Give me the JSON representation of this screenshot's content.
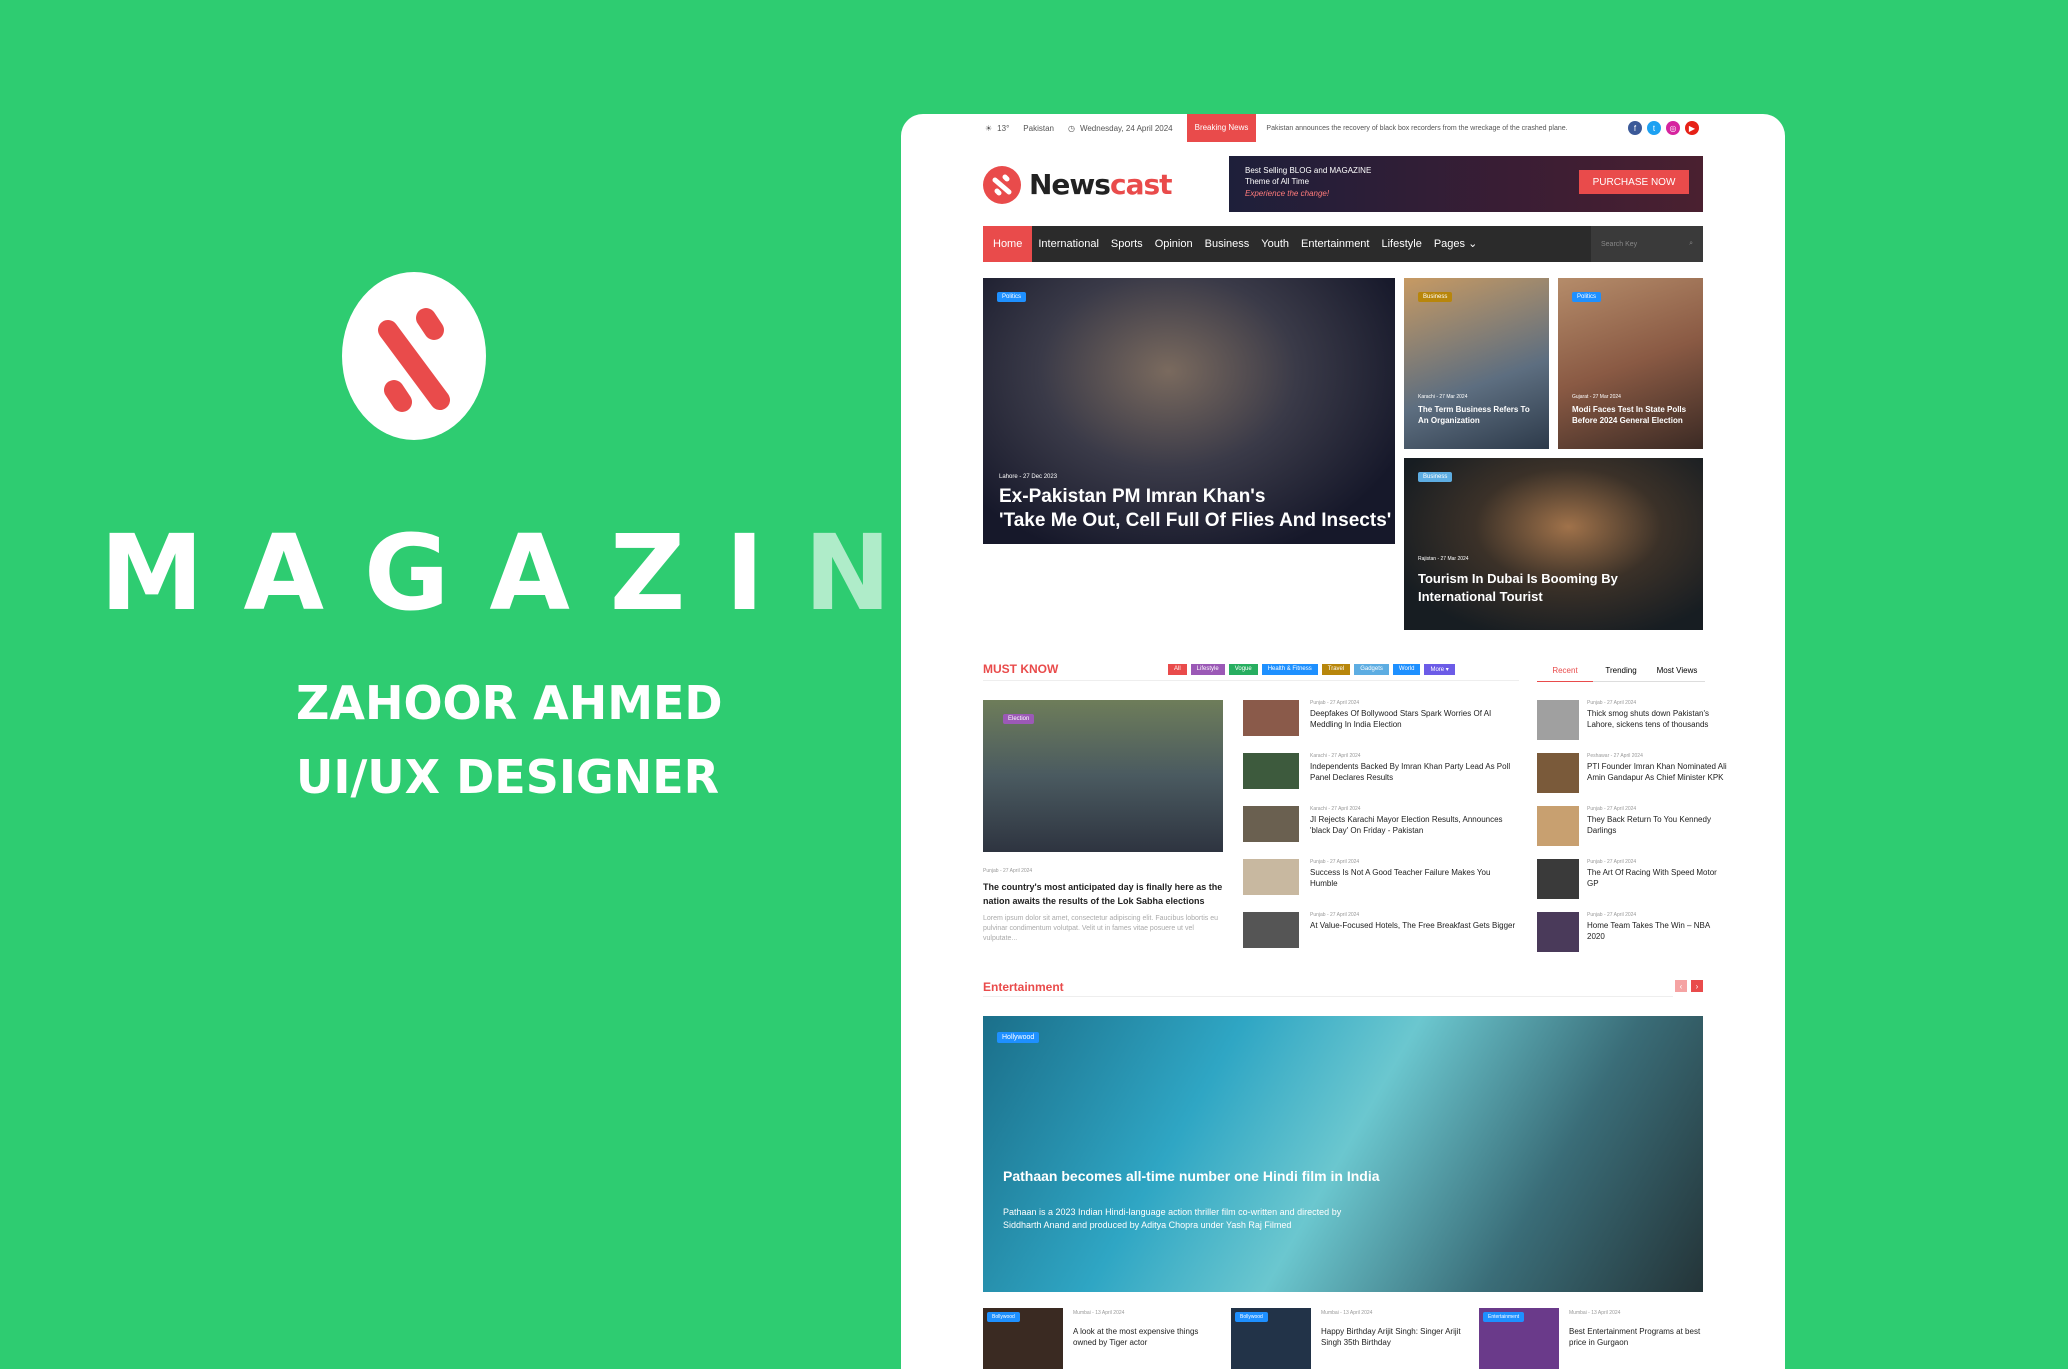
{
  "brand": {
    "word_main": "MAGAZI",
    "word_fade": "NE",
    "author": "ZAHOOR AHMED",
    "role": "UI/UX DESIGNER",
    "accent": "#e94b4b",
    "background": "#2ecc71"
  },
  "topbar": {
    "temperature": "13°",
    "location": "Pakistan",
    "date": "Wednesday, 24 April 2024",
    "breaking_label": "Breaking News",
    "breaking_text": "Pakistan announces the recovery of black box recorders from the wreckage of the crashed plane.",
    "socials": [
      {
        "icon": "facebook-icon",
        "glyph": "f",
        "color": "#3b5998"
      },
      {
        "icon": "twitter-icon",
        "glyph": "t",
        "color": "#1da1f2"
      },
      {
        "icon": "instagram-icon",
        "glyph": "◎",
        "color": "#d6249f"
      },
      {
        "icon": "youtube-icon",
        "glyph": "▶",
        "color": "#e62117"
      }
    ]
  },
  "header": {
    "logo_a": "News",
    "logo_b": "cast",
    "promo_line1": "Best Selling BLOG and MAGAZINE",
    "promo_line2": "Theme of All Time",
    "promo_line3": "Experience the change!",
    "promo_button": "PURCHASE NOW"
  },
  "nav": {
    "items": [
      "Home",
      "International",
      "Sports",
      "Opinion",
      "Business",
      "Youth",
      "Entertainment",
      "Lifestyle",
      "Pages"
    ],
    "search_placeholder": "Search Key"
  },
  "hero": {
    "main": {
      "tag": "Politics",
      "meta": "Lahore - 27 Dec 2023",
      "title1": "Ex-Pakistan PM Imran Khan's",
      "title2": "'Take Me Out, Cell Full Of Flies And Insects'"
    },
    "card1": {
      "tag": "Business",
      "meta": "Karachi - 27 Mar 2024",
      "title": "The Term Business Refers To An Organization"
    },
    "card2": {
      "tag": "Politics",
      "meta": "Gujarat - 27 Mar 2024",
      "title": "Modi Faces Test In State Polls Before 2024 General Election"
    },
    "card3": {
      "tag": "Business",
      "meta": "Rajistan - 27 Mar 2024",
      "title": "Tourism In Dubai Is Booming By International Tourist"
    }
  },
  "must_know": {
    "title": "MUST KNOW",
    "pills": [
      {
        "label": "All",
        "color": "#e94b4b"
      },
      {
        "label": "Lifestyle",
        "color": "#9b59b6"
      },
      {
        "label": "Vogue",
        "color": "#27ae60"
      },
      {
        "label": "Health & Fitness",
        "color": "#1e90ff"
      },
      {
        "label": "Travel",
        "color": "#b8860b"
      },
      {
        "label": "Gadgets",
        "color": "#5dade2"
      },
      {
        "label": "World",
        "color": "#1e90ff"
      },
      {
        "label": "More ▾",
        "color": "#6c5ce7"
      }
    ],
    "feature": {
      "tag": "Election",
      "meta": "Punjab - 27 April 2024",
      "title": "The country's most anticipated day is finally here as the nation awaits the results of the Lok Sabha elections",
      "excerpt": "Lorem ipsum dolor sit amet, consectetur adipiscing elit. Faucibus lobortis eu pulvinar condimentum volutpat. Velit ut in fames vitae posuere ut vel vulputate..."
    },
    "list": [
      {
        "meta": "Punjab - 27 April 2024",
        "title": "Deepfakes Of Bollywood Stars Spark Worries Of AI Meddling In India Election"
      },
      {
        "meta": "Karachi - 27 April 2024",
        "title": "Independents Backed By Imran Khan Party Lead As Poll Panel Declares Results"
      },
      {
        "meta": "Karachi - 27 April 2024",
        "title": "JI Rejects Karachi Mayor Election Results, Announces 'black Day' On Friday - Pakistan"
      },
      {
        "meta": "Punjab - 27 April 2024",
        "title": "Success Is Not A Good Teacher Failure Makes You Humble"
      },
      {
        "meta": "Punjab - 27 April 2024",
        "title": "At Value-Focused Hotels, The Free Breakfast Gets Bigger"
      }
    ]
  },
  "sidebar": {
    "tabs": [
      "Recent",
      "Trending",
      "Most Views"
    ],
    "items": [
      {
        "meta": "Punjab - 27 April 2024",
        "title": "Thick smog shuts down Pakistan's Lahore, sickens tens of thousands"
      },
      {
        "meta": "Peshawar - 27 April 2024",
        "title": "PTI Founder Imran Khan Nominated Ali Amin Gandapur As Chief Minister KPK"
      },
      {
        "meta": "Punjab - 27 April 2024",
        "title": "They Back Return To You Kennedy Darlings"
      },
      {
        "meta": "Punjab - 27 April 2024",
        "title": "The Art Of Racing With Speed Motor GP"
      },
      {
        "meta": "Punjab - 27 April 2024",
        "title": "Home Team Takes The Win – NBA 2020"
      }
    ]
  },
  "entertainment": {
    "title": "Entertainment",
    "banner_tag": "Hollywood",
    "banner_title": "Pathaan becomes all-time number one Hindi film in India",
    "banner_text": "Pathaan is a 2023 Indian Hindi-language action thriller film co-written and directed by Siddharth Anand and produced by Aditya Chopra under Yash Raj Filmed",
    "cards": [
      {
        "tag": "Bollywood",
        "meta": "Mumbai - 13 April 2024",
        "title": "A look at the most expensive things owned by Tiger actor"
      },
      {
        "tag": "Bollywood",
        "meta": "Mumbai - 13 April 2024",
        "title": "Happy Birthday Arijit Singh: Singer Arijit Singh 35th Birthday"
      },
      {
        "tag": "Entertainment",
        "meta": "Mumbai - 13 April 2024",
        "title": "Best Entertainment Programs at best price in Gurgaon"
      }
    ]
  }
}
